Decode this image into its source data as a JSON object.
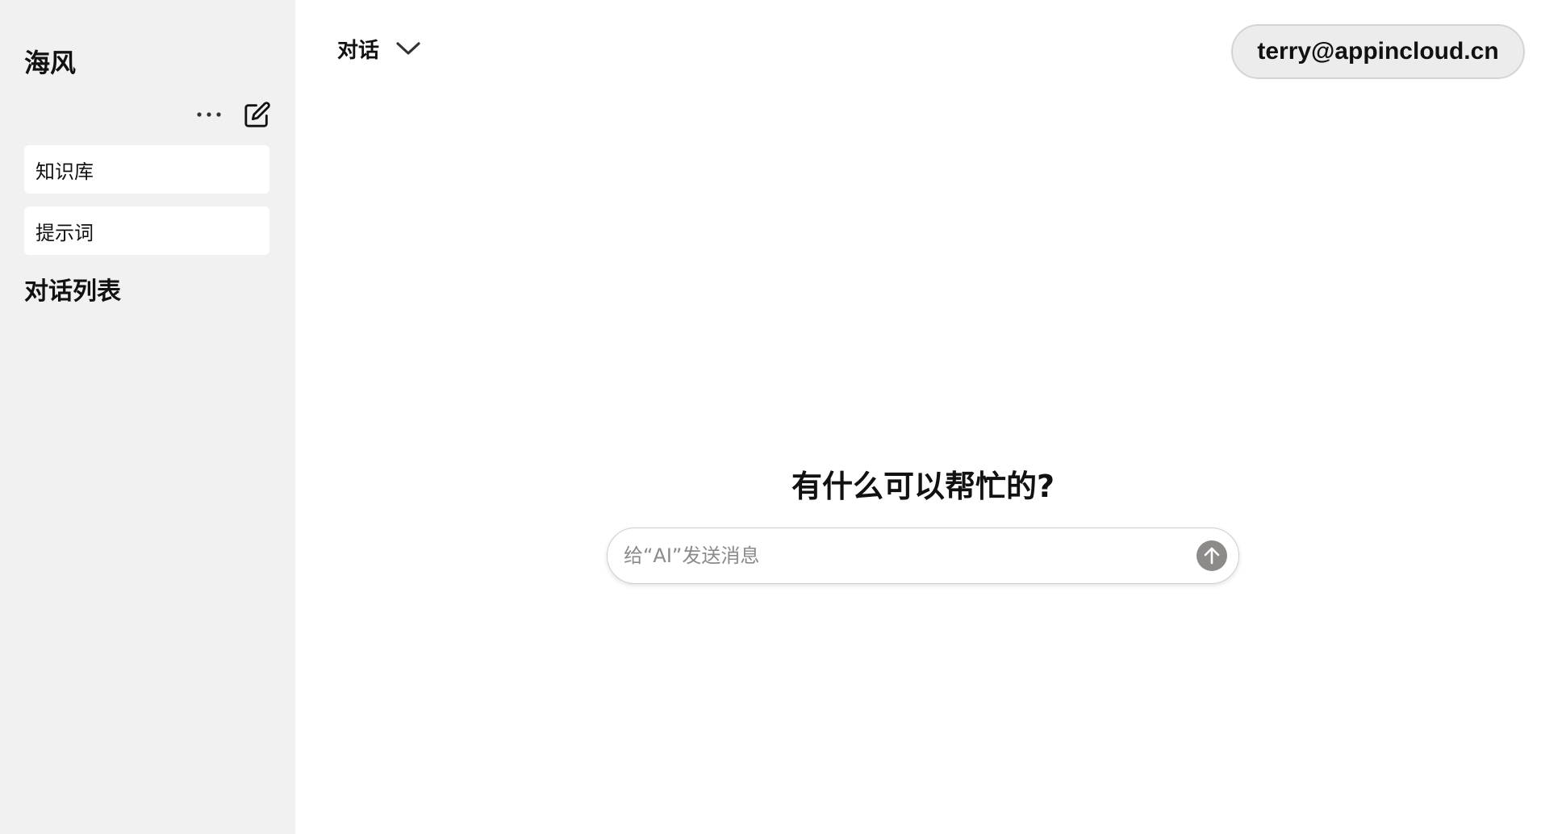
{
  "sidebar": {
    "brand": "海风",
    "actions": {
      "more_icon": "ellipsis-icon",
      "new_chat_icon": "edit-icon"
    },
    "items": [
      {
        "label": "知识库"
      },
      {
        "label": "提示词"
      }
    ],
    "conversations_title": "对话列表"
  },
  "header": {
    "mode_label": "对话",
    "mode_icon": "chevron-down-icon",
    "user_email": "terry@appincloud.cn"
  },
  "main": {
    "greeting": "有什么可以帮忙的?",
    "composer": {
      "placeholder": "给“AI”发送消息",
      "value": "",
      "send_icon": "arrow-up-icon"
    }
  },
  "colors": {
    "sidebar_bg": "#f1f1f1",
    "send_button": "#8d8a8a",
    "user_pill_bg": "#ececec"
  }
}
